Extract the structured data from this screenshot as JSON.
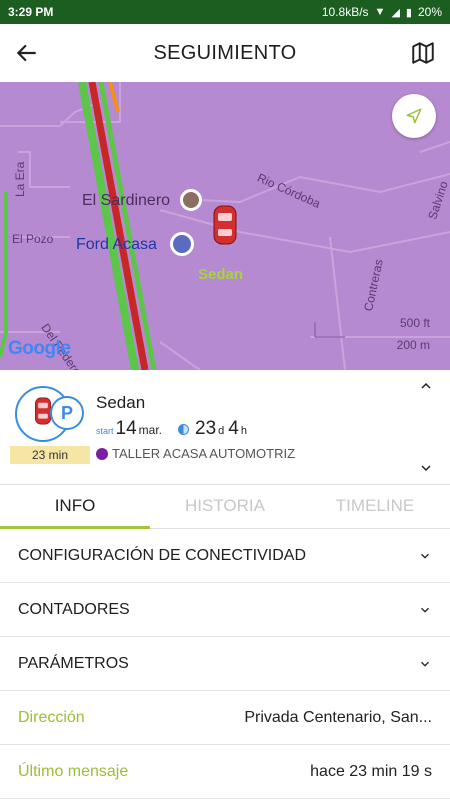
{
  "status_bar": {
    "time": "3:29 PM",
    "network_speed": "10.8kB/s",
    "battery": "20%"
  },
  "app_bar": {
    "title": "SEGUIMIENTO",
    "back_icon": "arrow-left-icon",
    "map_icon": "map-icon"
  },
  "map": {
    "labels": {
      "el_sardinero": "El Sardinero",
      "ford_acasa": "Ford Acasa",
      "sedan": "Sedan",
      "rio_cordoba": "Rio Córdoba",
      "la_era": "La Era",
      "el_pozo": "El Pozo",
      "contreras": "Contreras",
      "del_pedero": "Del Pedero",
      "salvino": "Salvino"
    },
    "scale_ft": "500 ft",
    "scale_m": "200 m",
    "brand": "Google",
    "colors": {
      "background": "#b68ad0",
      "road_green": "#5cc649",
      "road_red": "#c62828",
      "label": "#5b3a72",
      "vehicle_label": "#a7d33b"
    }
  },
  "vehicle": {
    "name": "Sedan",
    "start_label": "start",
    "start_day": "14",
    "start_month": "mar.",
    "age_days": "23",
    "age_days_unit": "d",
    "age_hours": "4",
    "age_hours_unit": "h",
    "location": "TALLER ACASA AUTOMOTRIZ",
    "stop_duration": "23 min",
    "parked_glyph": "P",
    "colors": {
      "accent": "#3a8dde",
      "location_dot": "#7b1fa2",
      "duration_bg": "#f5e6a6"
    }
  },
  "tabs": [
    {
      "label": "INFO",
      "active": true
    },
    {
      "label": "HISTORIA",
      "active": false
    },
    {
      "label": "TIMELINE",
      "active": false
    }
  ],
  "sections": [
    {
      "label": "CONFIGURACIÓN DE CONECTIVIDAD"
    },
    {
      "label": "CONTADORES"
    },
    {
      "label": "PARÁMETROS"
    }
  ],
  "details": [
    {
      "key": "Dirección",
      "value": "Privada Centenario, San..."
    },
    {
      "key": "Último mensaje",
      "value": "hace 23 min 19 s"
    }
  ],
  "accent_color": "#a4c63a"
}
